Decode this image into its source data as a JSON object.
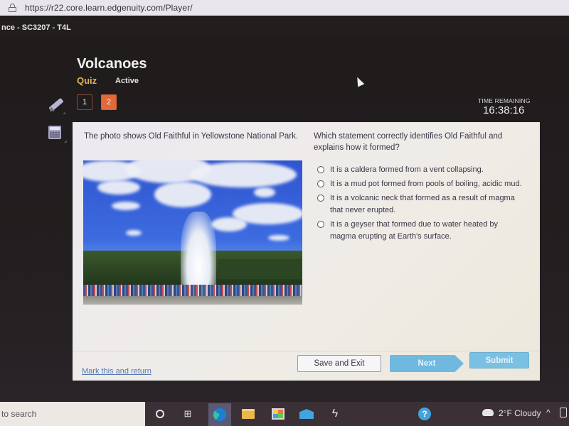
{
  "browser": {
    "url": "https://r22.core.learn.edgenuity.com/Player/"
  },
  "course": {
    "title": "nce - SC3207 - T4L"
  },
  "lesson": {
    "title": "Volcanoes",
    "type": "Quiz",
    "status": "Active"
  },
  "tools": [
    "pencil-icon",
    "calculator-icon"
  ],
  "question_nav": [
    {
      "label": "1",
      "state": "visited"
    },
    {
      "label": "2",
      "state": "current"
    }
  ],
  "timer": {
    "label": "TIME REMAINING",
    "value": "16:38:16"
  },
  "content": {
    "prompt": "The photo shows Old Faithful in Yellowstone National Park.",
    "photo_alt": "Old Faithful geyser erupting with crowd of visitors on boardwalk",
    "question": "Which statement correctly identifies Old Faithful and explains how it formed?",
    "choices": [
      "It is a caldera formed from a vent collapsing.",
      "It is a mud pot formed from pools of boiling, acidic mud.",
      "It is a volcanic neck that formed as a result of magma that never erupted.",
      "It is a geyser that formed due to water heated by magma erupting at Earth's surface."
    ]
  },
  "footer": {
    "mark_link": "Mark this and return",
    "save_exit": "Save and Exit",
    "next": "Next",
    "submit": "Submit"
  },
  "taskbar": {
    "search_placeholder": "to search",
    "weather": "2°F  Cloudy",
    "tray_chevron": "^",
    "apps": [
      "cortana-icon",
      "task-view-icon",
      "edge-icon",
      "file-explorer-icon",
      "store-icon",
      "mail-icon",
      "bolt-app-icon",
      "help-icon"
    ]
  },
  "colors": {
    "accent_orange": "#e2683a",
    "quiz_label": "#e3b35a",
    "button_blue": "#6fb8e0",
    "link_blue": "#5578b0"
  }
}
